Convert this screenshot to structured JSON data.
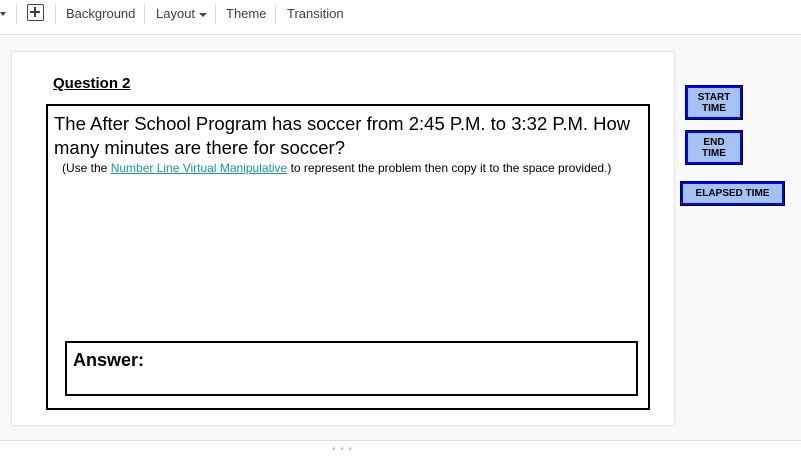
{
  "toolbar": {
    "background_label": "Background",
    "layout_label": "Layout",
    "theme_label": "Theme",
    "transition_label": "Transition",
    "new_slide_icon": "add-box-icon",
    "dropdown_icon": "caret-down-icon"
  },
  "slide": {
    "title": "Question 2",
    "question": "The After School Program has soccer from 2:45 P.M. to 3:32 P.M. How many minutes are there for soccer?",
    "note_prefix": "(Use the ",
    "note_link": "Number Line Virtual Manipulative",
    "note_suffix": " to represent the problem then copy it to the space provided.)",
    "answer_label": "Answer:"
  },
  "side_buttons": {
    "start_line1": "START",
    "start_line2": "TIME",
    "end_line1": "END",
    "end_line2": "TIME",
    "elapsed": "ELAPSED TIME",
    "fill_color": "#a4c2f4",
    "border_color": "#0000ff"
  },
  "handle_text": "• • •"
}
